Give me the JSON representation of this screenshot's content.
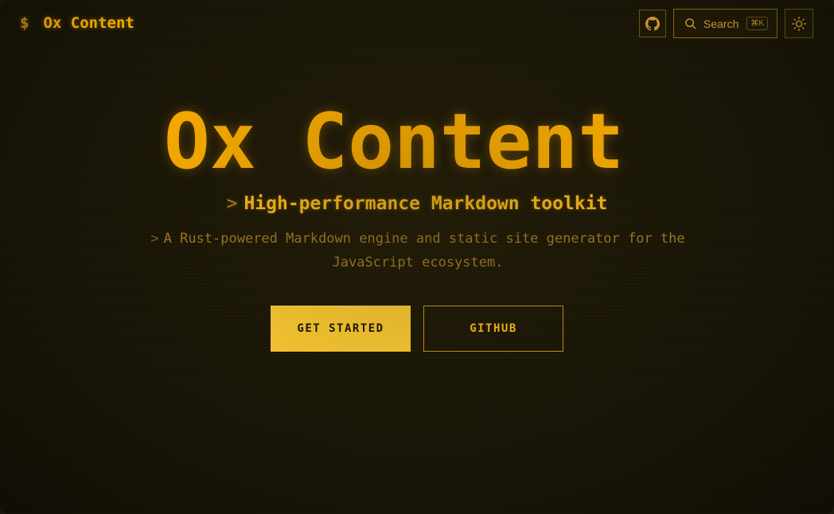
{
  "header": {
    "brand_prompt": "$",
    "brand_name": "Ox Content",
    "github_icon": "github-icon",
    "search": {
      "icon": "search-icon",
      "label": "Search",
      "shortcut": "⌘K"
    },
    "theme_icon": "sun-icon"
  },
  "hero": {
    "title": "Ox Content",
    "tagline_prompt": ">",
    "tagline": "High-performance Markdown toolkit",
    "description_prompt": ">",
    "description": "A Rust-powered Markdown engine and static site generator for the JavaScript ecosystem.",
    "primary_button": "GET STARTED",
    "secondary_button": "GITHUB"
  },
  "colors": {
    "background": "#1b1708",
    "accent": "#ffb000",
    "primary_button": "#ffcc33",
    "muted_text": "#a47a28"
  }
}
